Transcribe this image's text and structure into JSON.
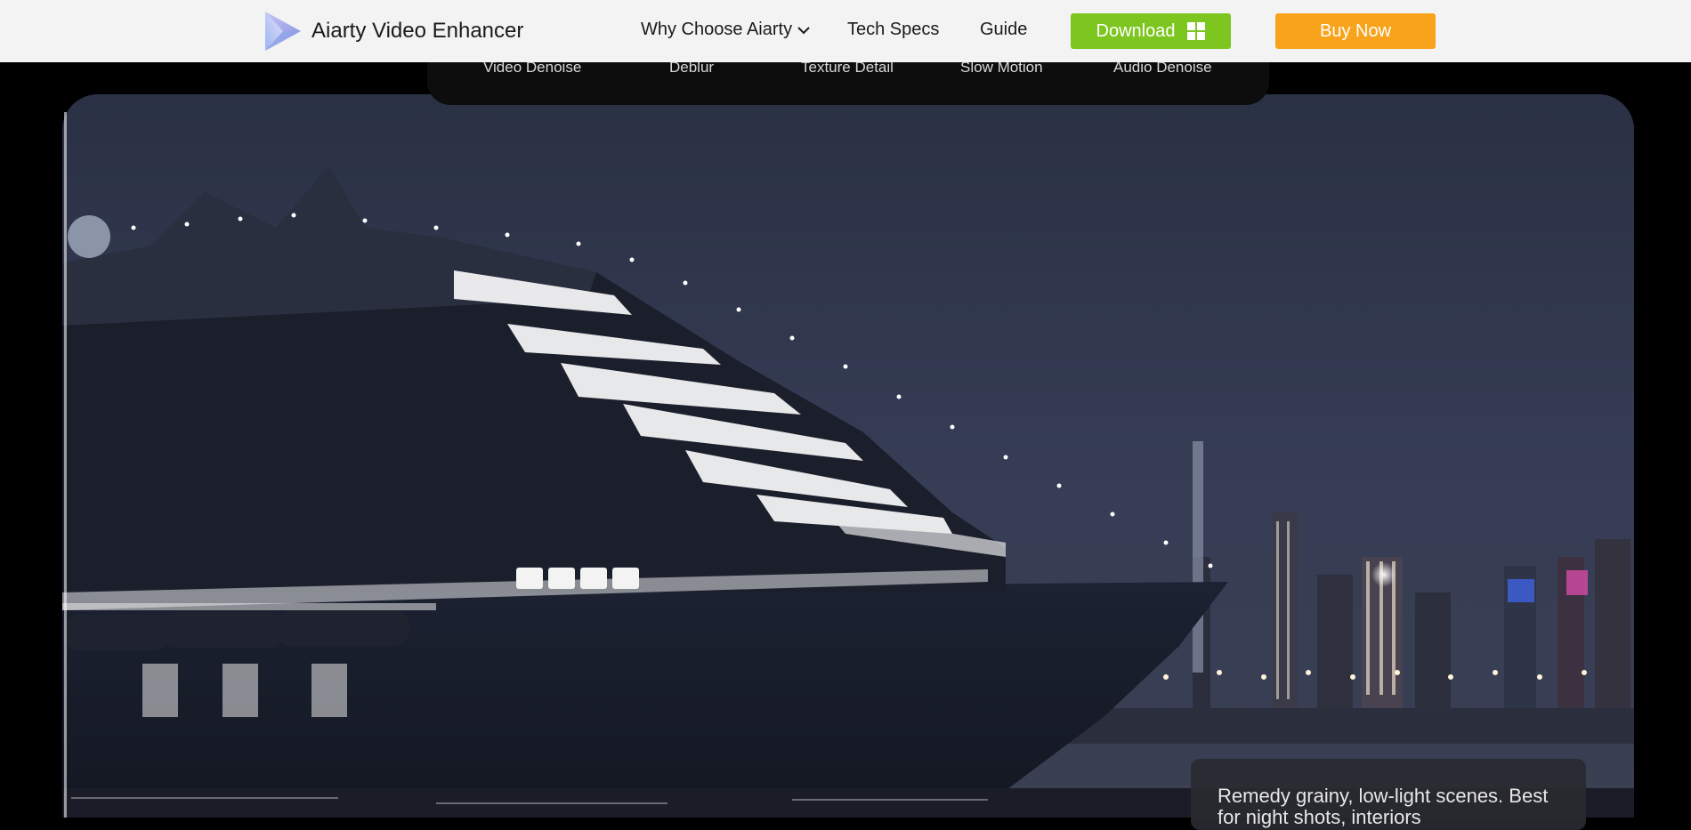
{
  "brand": {
    "name": "Aiarty Video Enhancer",
    "logo_icon": "aiarty-logo-icon"
  },
  "nav": {
    "why_choose": "Why Choose Aiarty",
    "tech_specs": "Tech Specs",
    "guide": "Guide",
    "download": "Download",
    "buy_now": "Buy Now"
  },
  "feature_tabs": [
    "Video Denoise",
    "Deblur",
    "Texture Detail",
    "Slow Motion",
    "Audio Denoise"
  ],
  "caption": {
    "text": "Remedy grainy, low-light scenes. Best for night shots, interiors"
  },
  "colors": {
    "download_green": "#7cc61f",
    "buy_orange": "#f8a31b",
    "nav_bg": "#f3f3f3",
    "page_bg": "#000000"
  },
  "icons": [
    "chevron-down-icon",
    "windows-icon"
  ]
}
